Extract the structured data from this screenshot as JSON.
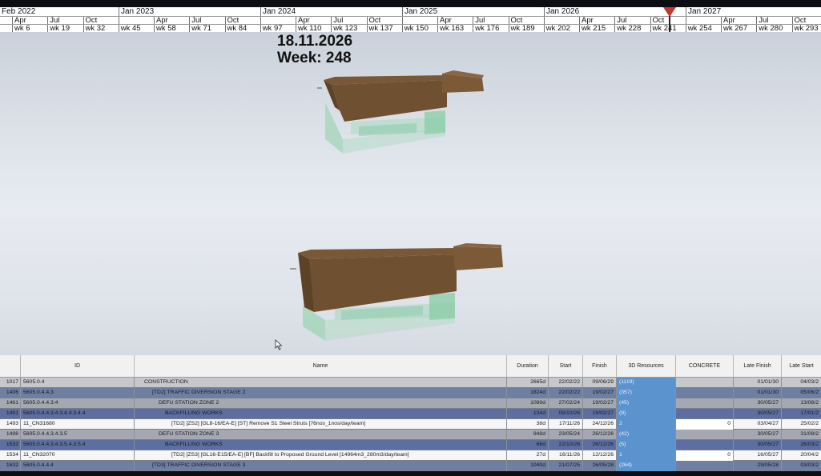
{
  "timeline": {
    "years": [
      "Feb 2022",
      "Jan 2023",
      "Jan 2024",
      "Jan 2025",
      "Jan 2026",
      "Jan 2027"
    ],
    "months": [
      "Apr",
      "Jul",
      "Oct",
      "",
      "Apr",
      "Jul",
      "Oct",
      "",
      "Apr",
      "Jul",
      "Oct",
      "",
      "Apr",
      "Jul",
      "Oct",
      "",
      "Apr",
      "Jul",
      "Oct",
      "",
      "Apr",
      "Jul",
      "Oct"
    ],
    "weeks": [
      "wk 6",
      "wk 19",
      "wk 32",
      "wk 45",
      "wk 58",
      "wk 71",
      "wk 84",
      "wk 97",
      "wk 110",
      "wk 123",
      "wk 137",
      "wk 150",
      "wk 163",
      "wk 176",
      "wk 189",
      "wk 202",
      "wk 215",
      "wk 228",
      "wk 241",
      "wk 254",
      "wk 267",
      "wk 280",
      "wk 293"
    ],
    "marker_color": "#c0392b"
  },
  "viewport": {
    "date": "18.11.2026",
    "week": "Week: 248"
  },
  "table": {
    "headers": {
      "rownum": "",
      "id": "ID",
      "name": "Name",
      "duration": "Duration",
      "start": "Start",
      "finish": "Finish",
      "resources_3d": "3D Resources",
      "concrete": "CONCRETE",
      "late_finish": "Late Finish",
      "late_start": "Late Start"
    },
    "rows": [
      {
        "rownum": "1017",
        "id": "5605.0.4",
        "name": "CONSTRUCTION",
        "duration": "2665d",
        "start": "22/02/22",
        "finish": "09/06/29",
        "res": "(1119)",
        "conc": "",
        "lfin": "01/01/30",
        "lstart": "04/03/2",
        "bg": "#c6c8cc",
        "color": "#1a1a1a",
        "indent": 12
      },
      {
        "rownum": "1406",
        "id": "5605.0.4.4.3",
        "name": "[TD2] TRAFFIC DIVERSION STAGE 2",
        "duration": "1824d",
        "start": "22/02/22",
        "finish": "19/02/27",
        "res": "(357)",
        "conc": "",
        "lfin": "01/01/30",
        "lstart": "05/06/2",
        "bg": "#6e7fa2",
        "color": "#101828",
        "indent": 22
      },
      {
        "rownum": "1461",
        "id": "5605.0.4.4.3.4",
        "name": "DEFU STATION ZONE 2",
        "duration": "1089d",
        "start": "27/02/24",
        "finish": "19/02/27",
        "res": "(45)",
        "conc": "",
        "lfin": "30/05/27",
        "lstart": "13/08/2",
        "bg": "#a3a8b3",
        "color": "#1a1a1a",
        "indent": 30
      },
      {
        "rownum": "1491",
        "id": "5605.0.4.4.3.4.3.4.4.3.4.4",
        "name": "BACKFILLING WORKS",
        "duration": "134d",
        "start": "09/10/26",
        "finish": "19/02/27",
        "res": "(9)",
        "conc": "",
        "lfin": "30/05/27",
        "lstart": "17/01/2",
        "bg": "#5c6fa0",
        "color": "#101828",
        "indent": 38
      },
      {
        "rownum": "1493",
        "id": "11_CN31680",
        "name": "[TD2] [ZS2] [GL8-16/EA-E] [ST] Remove S1 Steel Struts [76nos_1nos/day/team]",
        "duration": "38d",
        "start": "17/11/26",
        "finish": "24/12/26",
        "res": "2",
        "conc": "0",
        "lfin": "03/04/27",
        "lstart": "25/02/2",
        "bg": "#f6f6f6",
        "color": "#1a1a1a",
        "indent": 46
      },
      {
        "rownum": "1498",
        "id": "5605.0.4.4.3.4.3.5",
        "name": "DEFU STATION ZONE 3",
        "duration": "948d",
        "start": "23/05/24",
        "finish": "26/12/26",
        "res": "(42)",
        "conc": "",
        "lfin": "30/05/27",
        "lstart": "31/08/2",
        "bg": "#a3a8b3",
        "color": "#1a1a1a",
        "indent": 30
      },
      {
        "rownum": "1532",
        "id": "5605.0.4.4.3.4.3.5.4.3.5.4",
        "name": "BACKFILLING WORKS",
        "duration": "66d",
        "start": "22/10/26",
        "finish": "26/12/26",
        "res": "(5)",
        "conc": "",
        "lfin": "30/05/27",
        "lstart": "26/03/2",
        "bg": "#5c6fa0",
        "color": "#101828",
        "indent": 38
      },
      {
        "rownum": "1534",
        "id": "11_CN32070",
        "name": "[TD2] [ZS3] [GL16-E15/EA-E] [BF] Backfill to Proposed Ground Level [14964m3_280m3/day/team]",
        "duration": "27d",
        "start": "16/11/26",
        "finish": "12/12/26",
        "res": "1",
        "conc": "0",
        "lfin": "16/05/27",
        "lstart": "20/04/2",
        "bg": "#f6f6f6",
        "color": "#1a1a1a",
        "indent": 46
      },
      {
        "rownum": "1632",
        "id": "5605.0.4.4.4",
        "name": "[TD3] TRAFFIC DIVERSION STAGE 3",
        "duration": "1040d",
        "start": "21/07/25",
        "finish": "26/05/28",
        "res": "(264)",
        "conc": "",
        "lfin": "29/05/28",
        "lstart": "03/03/2",
        "bg": "#6e7fa2",
        "color": "#101828",
        "indent": 22
      }
    ],
    "resource_cell_color": "#5b93cf"
  }
}
